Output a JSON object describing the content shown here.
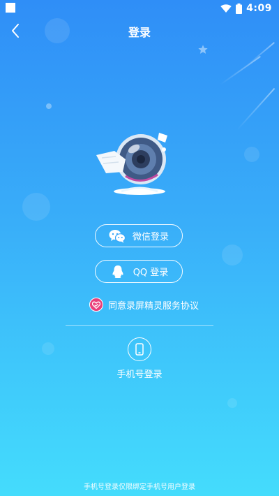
{
  "status_bar": {
    "time": "4:09",
    "wifi_icon": "wifi-icon",
    "battery_icon": "battery-icon"
  },
  "header": {
    "title": "登录",
    "back_icon": "back-arrow-icon"
  },
  "logo": {
    "icon": "camera-lens-logo"
  },
  "buttons": {
    "wechat": {
      "label": "微信登录",
      "icon": "wechat-icon"
    },
    "qq": {
      "label": "QQ 登录",
      "icon": "qq-icon"
    }
  },
  "agreement": {
    "prefix": "同意",
    "link": "录屏精灵服务协议",
    "checked": true,
    "check_color": "#e9407a"
  },
  "phone_login": {
    "label": "手机号登录",
    "icon": "mobile-phone-icon"
  },
  "footer_note": "手机号登录仅限绑定手机号用户登录",
  "colors": {
    "gradient_top": "#2f8ef7",
    "gradient_bottom": "#44dcfc",
    "accent": "#e9407a"
  }
}
